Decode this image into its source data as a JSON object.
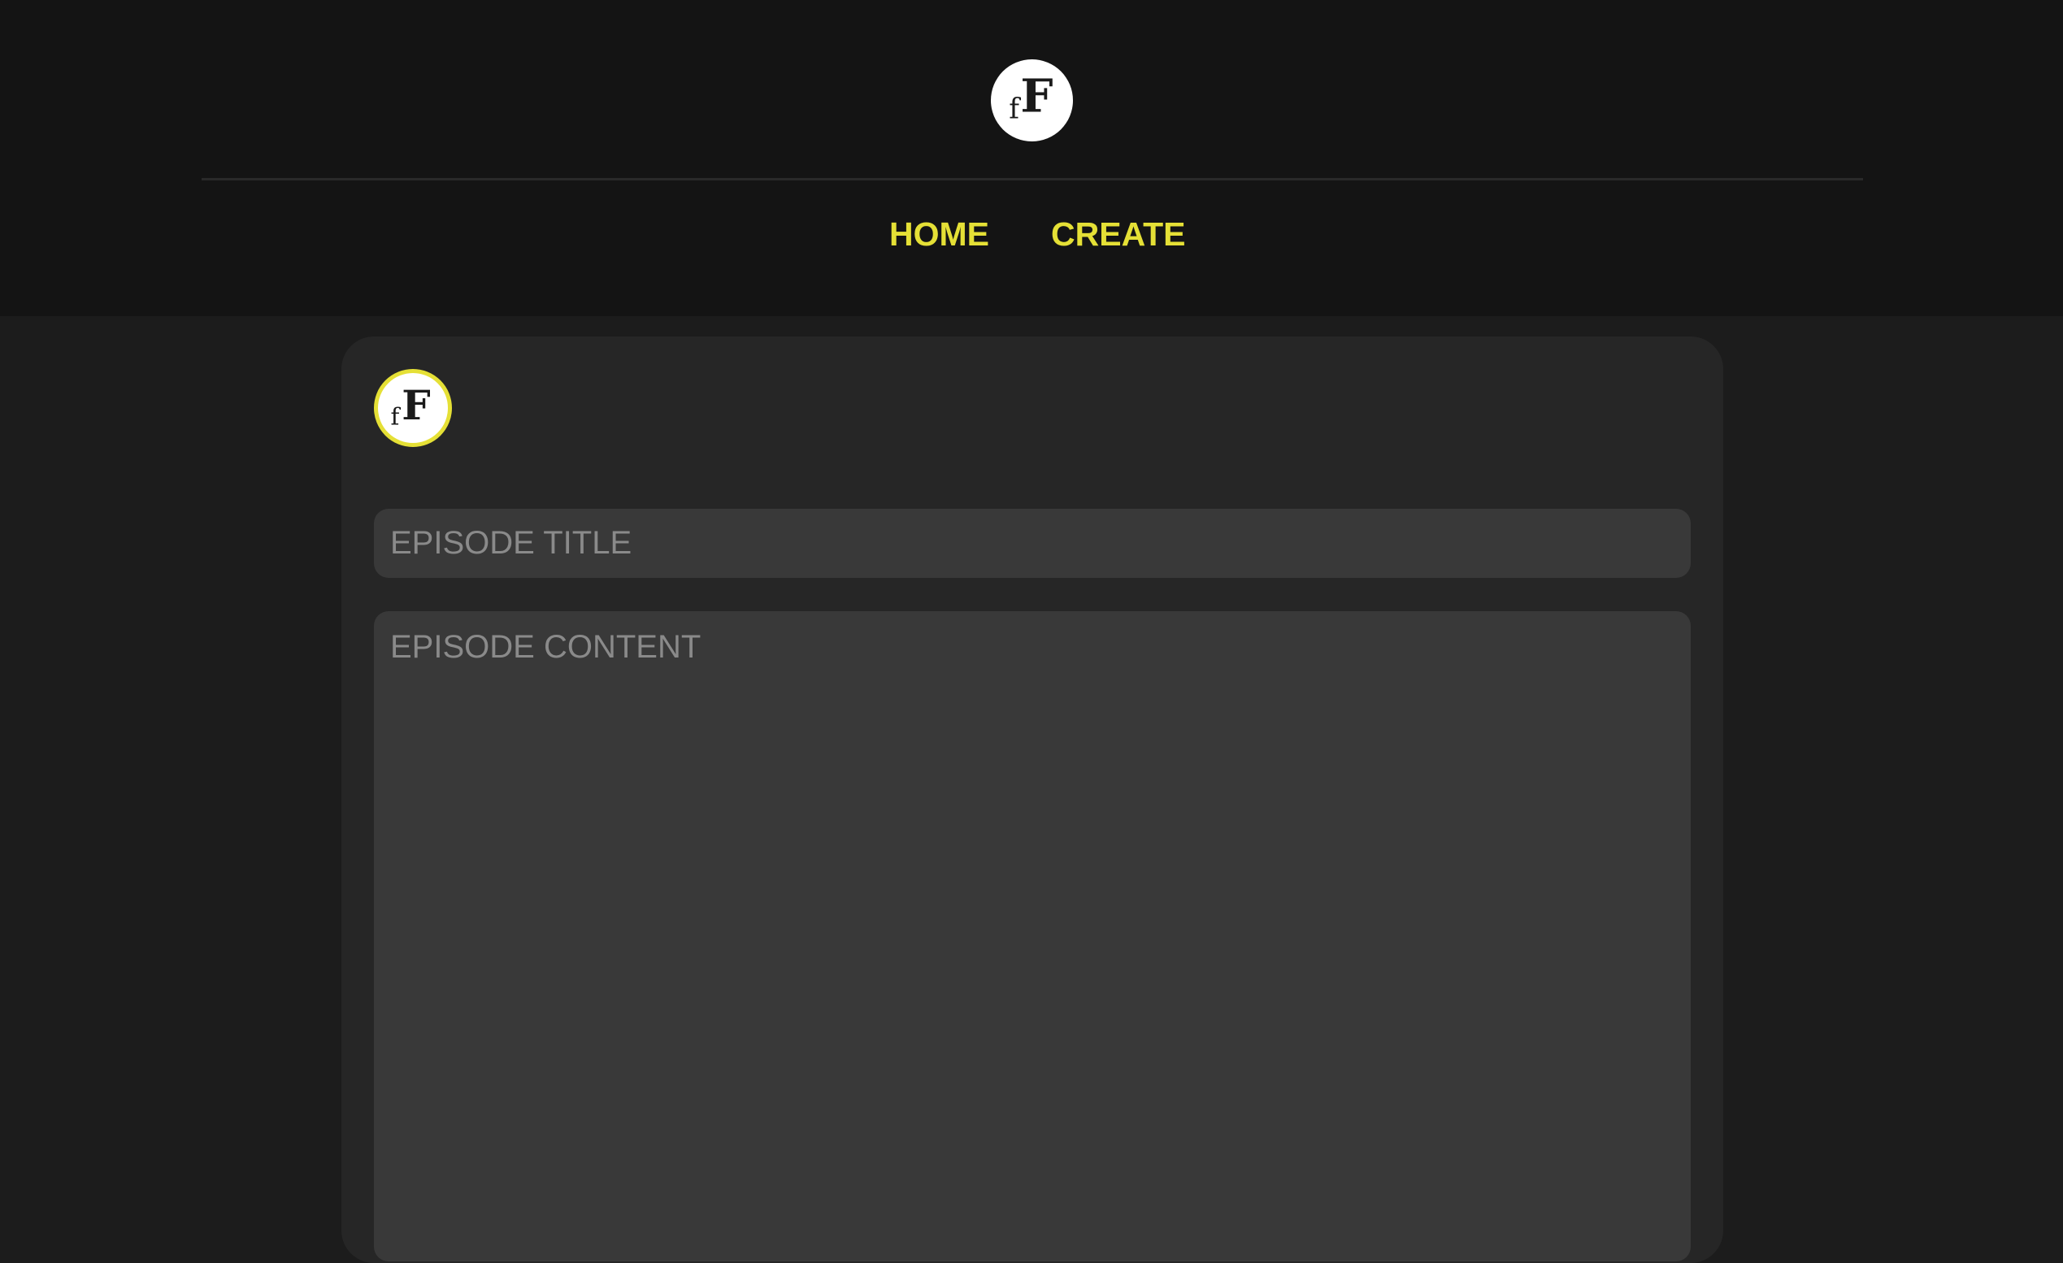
{
  "header": {
    "logo_icon": "ff-logo-icon",
    "logo_text": "fF",
    "nav": {
      "home_label": "HOME",
      "create_label": "CREATE"
    }
  },
  "form": {
    "avatar_icon": "ff-logo-icon",
    "avatar_text": "fF",
    "title_placeholder": "EPISODE TITLE",
    "title_value": "",
    "content_placeholder": "EPISODE CONTENT",
    "content_value": ""
  },
  "colors": {
    "accent": "#e5e036",
    "header_background": "#141414",
    "page_background": "#1c1c1c",
    "card_background": "#262626",
    "field_background": "#393939",
    "placeholder_text": "#8a8a8a"
  }
}
